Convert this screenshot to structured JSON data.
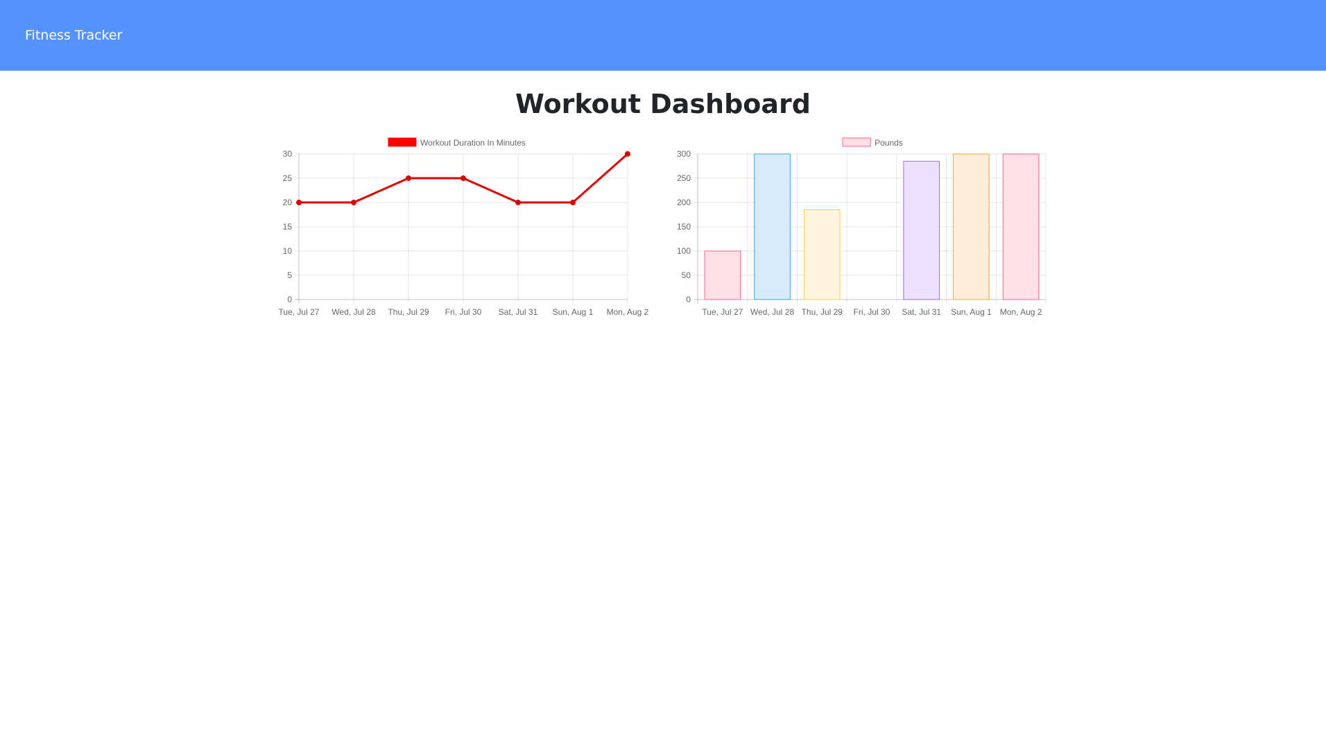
{
  "navbar": {
    "brand": "Fitness Tracker"
  },
  "main": {
    "title": "Workout Dashboard"
  },
  "colors": {
    "navbar": "#5692fb",
    "line": "#e00000",
    "line_legend": "#ff0000"
  },
  "chart_data": [
    {
      "type": "line",
      "categories": [
        "Tue, Jul 27",
        "Wed, Jul 28",
        "Thu, Jul 29",
        "Fri, Jul 30",
        "Sat, Jul 31",
        "Sun, Aug 1",
        "Mon, Aug 2"
      ],
      "series": [
        {
          "name": "Workout Duration In Minutes",
          "values": [
            20,
            20,
            25,
            25,
            20,
            20,
            30
          ]
        }
      ],
      "yticks": [
        0,
        5,
        10,
        15,
        20,
        25,
        30
      ],
      "ylim": [
        0,
        30
      ],
      "legend": "top",
      "grid": true
    },
    {
      "type": "bar",
      "categories": [
        "Tue, Jul 27",
        "Wed, Jul 28",
        "Thu, Jul 29",
        "Fri, Jul 30",
        "Sat, Jul 31",
        "Sun, Aug 1",
        "Mon, Aug 2"
      ],
      "series": [
        {
          "name": "Pounds",
          "values": [
            100,
            300,
            185,
            0,
            285,
            300,
            300
          ]
        }
      ],
      "bar_colors": [
        {
          "fill": "#ffe0e6",
          "stroke": "#ff6384"
        },
        {
          "fill": "#d7ecfb",
          "stroke": "#36a2eb"
        },
        {
          "fill": "#fff5dd",
          "stroke": "#ffcd56"
        },
        {
          "fill": "#dbf2f2",
          "stroke": "#4bc0c0"
        },
        {
          "fill": "#ebe0ff",
          "stroke": "#9966ff"
        },
        {
          "fill": "#ffecd9",
          "stroke": "#ff9f40"
        },
        {
          "fill": "#ffe0e6",
          "stroke": "#ff6384"
        }
      ],
      "yticks": [
        0,
        50,
        100,
        150,
        200,
        250,
        300
      ],
      "ylim": [
        0,
        300
      ],
      "legend": "top",
      "grid": true
    }
  ]
}
